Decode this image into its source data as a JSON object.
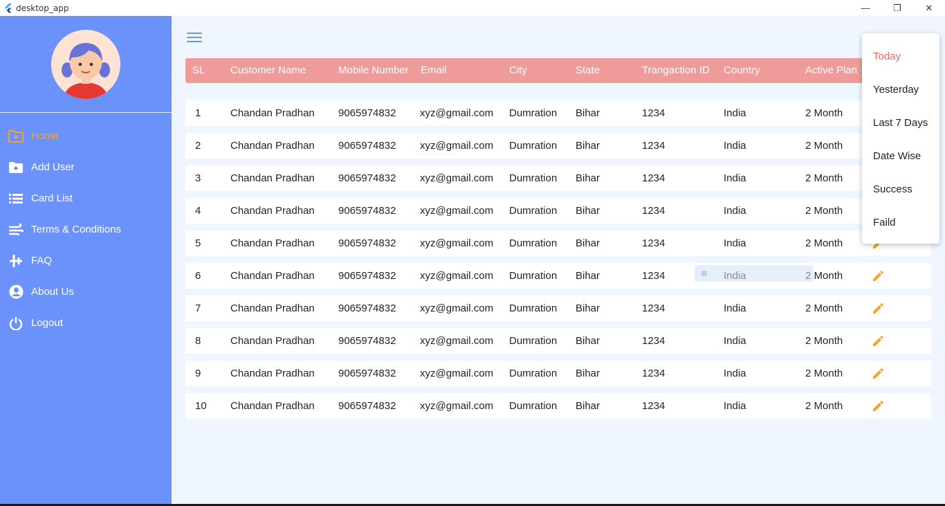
{
  "window": {
    "title": "desktop_app"
  },
  "sidebar": {
    "items": [
      {
        "label": "Home",
        "icon": "folder-add-icon",
        "active": true
      },
      {
        "label": "Add User",
        "icon": "folder-add-icon",
        "active": false
      },
      {
        "label": "Card List",
        "icon": "list-icon",
        "active": false
      },
      {
        "label": "Terms & Conditions",
        "icon": "wind-icon",
        "active": false
      },
      {
        "label": "FAQ",
        "icon": "airplane-icon",
        "active": false
      },
      {
        "label": "About Us",
        "icon": "account-circle-icon",
        "active": false
      },
      {
        "label": "Logout",
        "icon": "power-icon",
        "active": false
      }
    ]
  },
  "table": {
    "headers": [
      "SL",
      "Customer Name",
      "Mobile Number",
      "Email",
      "City",
      "State",
      "Trangaction ID",
      "Country",
      "Active Plan"
    ],
    "rows": [
      [
        "1",
        "Chandan Pradhan",
        "9065974832",
        "xyz@gmail.com",
        "Dumration",
        "Bihar",
        "1234",
        "India",
        "2 Month"
      ],
      [
        "2",
        "Chandan Pradhan",
        "9065974832",
        "xyz@gmail.com",
        "Dumration",
        "Bihar",
        "1234",
        "India",
        "2 Month"
      ],
      [
        "3",
        "Chandan Pradhan",
        "9065974832",
        "xyz@gmail.com",
        "Dumration",
        "Bihar",
        "1234",
        "India",
        "2 Month"
      ],
      [
        "4",
        "Chandan Pradhan",
        "9065974832",
        "xyz@gmail.com",
        "Dumration",
        "Bihar",
        "1234",
        "India",
        "2 Month"
      ],
      [
        "5",
        "Chandan Pradhan",
        "9065974832",
        "xyz@gmail.com",
        "Dumration",
        "Bihar",
        "1234",
        "India",
        "2 Month"
      ],
      [
        "6",
        "Chandan Pradhan",
        "9065974832",
        "xyz@gmail.com",
        "Dumration",
        "Bihar",
        "1234",
        "India",
        "2 Month"
      ],
      [
        "7",
        "Chandan Pradhan",
        "9065974832",
        "xyz@gmail.com",
        "Dumration",
        "Bihar",
        "1234",
        "India",
        "2 Month"
      ],
      [
        "8",
        "Chandan Pradhan",
        "9065974832",
        "xyz@gmail.com",
        "Dumration",
        "Bihar",
        "1234",
        "India",
        "2 Month"
      ],
      [
        "9",
        "Chandan Pradhan",
        "9065974832",
        "xyz@gmail.com",
        "Dumration",
        "Bihar",
        "1234",
        "India",
        "2 Month"
      ],
      [
        "10",
        "Chandan Pradhan",
        "9065974832",
        "xyz@gmail.com",
        "Dumration",
        "Bihar",
        "1234",
        "India",
        "2 Month"
      ]
    ],
    "edit_icon": "pencil-icon"
  },
  "filter_menu": {
    "items": [
      "Today",
      "Yesterday",
      "Last 7 Days",
      "Date Wise",
      "Success",
      "Faild"
    ],
    "selected": "Today"
  },
  "colors": {
    "sidebar": "#6b92fb",
    "active_nav": "#f5a623",
    "table_header": "#ef9b9a",
    "edit_icon": "#f5a623",
    "menu_selected": "#e8695a",
    "background": "#f0f6ff"
  }
}
